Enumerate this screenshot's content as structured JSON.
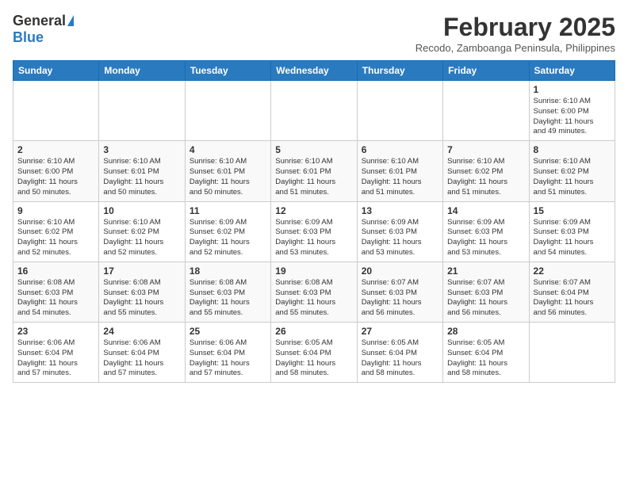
{
  "header": {
    "logo_general": "General",
    "logo_blue": "Blue",
    "month_title": "February 2025",
    "subtitle": "Recodo, Zamboanga Peninsula, Philippines"
  },
  "days_of_week": [
    "Sunday",
    "Monday",
    "Tuesday",
    "Wednesday",
    "Thursday",
    "Friday",
    "Saturday"
  ],
  "weeks": [
    [
      {
        "day": "",
        "info": ""
      },
      {
        "day": "",
        "info": ""
      },
      {
        "day": "",
        "info": ""
      },
      {
        "day": "",
        "info": ""
      },
      {
        "day": "",
        "info": ""
      },
      {
        "day": "",
        "info": ""
      },
      {
        "day": "1",
        "info": "Sunrise: 6:10 AM\nSunset: 6:00 PM\nDaylight: 11 hours\nand 49 minutes."
      }
    ],
    [
      {
        "day": "2",
        "info": "Sunrise: 6:10 AM\nSunset: 6:00 PM\nDaylight: 11 hours\nand 50 minutes."
      },
      {
        "day": "3",
        "info": "Sunrise: 6:10 AM\nSunset: 6:01 PM\nDaylight: 11 hours\nand 50 minutes."
      },
      {
        "day": "4",
        "info": "Sunrise: 6:10 AM\nSunset: 6:01 PM\nDaylight: 11 hours\nand 50 minutes."
      },
      {
        "day": "5",
        "info": "Sunrise: 6:10 AM\nSunset: 6:01 PM\nDaylight: 11 hours\nand 51 minutes."
      },
      {
        "day": "6",
        "info": "Sunrise: 6:10 AM\nSunset: 6:01 PM\nDaylight: 11 hours\nand 51 minutes."
      },
      {
        "day": "7",
        "info": "Sunrise: 6:10 AM\nSunset: 6:02 PM\nDaylight: 11 hours\nand 51 minutes."
      },
      {
        "day": "8",
        "info": "Sunrise: 6:10 AM\nSunset: 6:02 PM\nDaylight: 11 hours\nand 51 minutes."
      }
    ],
    [
      {
        "day": "9",
        "info": "Sunrise: 6:10 AM\nSunset: 6:02 PM\nDaylight: 11 hours\nand 52 minutes."
      },
      {
        "day": "10",
        "info": "Sunrise: 6:10 AM\nSunset: 6:02 PM\nDaylight: 11 hours\nand 52 minutes."
      },
      {
        "day": "11",
        "info": "Sunrise: 6:09 AM\nSunset: 6:02 PM\nDaylight: 11 hours\nand 52 minutes."
      },
      {
        "day": "12",
        "info": "Sunrise: 6:09 AM\nSunset: 6:03 PM\nDaylight: 11 hours\nand 53 minutes."
      },
      {
        "day": "13",
        "info": "Sunrise: 6:09 AM\nSunset: 6:03 PM\nDaylight: 11 hours\nand 53 minutes."
      },
      {
        "day": "14",
        "info": "Sunrise: 6:09 AM\nSunset: 6:03 PM\nDaylight: 11 hours\nand 53 minutes."
      },
      {
        "day": "15",
        "info": "Sunrise: 6:09 AM\nSunset: 6:03 PM\nDaylight: 11 hours\nand 54 minutes."
      }
    ],
    [
      {
        "day": "16",
        "info": "Sunrise: 6:08 AM\nSunset: 6:03 PM\nDaylight: 11 hours\nand 54 minutes."
      },
      {
        "day": "17",
        "info": "Sunrise: 6:08 AM\nSunset: 6:03 PM\nDaylight: 11 hours\nand 55 minutes."
      },
      {
        "day": "18",
        "info": "Sunrise: 6:08 AM\nSunset: 6:03 PM\nDaylight: 11 hours\nand 55 minutes."
      },
      {
        "day": "19",
        "info": "Sunrise: 6:08 AM\nSunset: 6:03 PM\nDaylight: 11 hours\nand 55 minutes."
      },
      {
        "day": "20",
        "info": "Sunrise: 6:07 AM\nSunset: 6:03 PM\nDaylight: 11 hours\nand 56 minutes."
      },
      {
        "day": "21",
        "info": "Sunrise: 6:07 AM\nSunset: 6:03 PM\nDaylight: 11 hours\nand 56 minutes."
      },
      {
        "day": "22",
        "info": "Sunrise: 6:07 AM\nSunset: 6:04 PM\nDaylight: 11 hours\nand 56 minutes."
      }
    ],
    [
      {
        "day": "23",
        "info": "Sunrise: 6:06 AM\nSunset: 6:04 PM\nDaylight: 11 hours\nand 57 minutes."
      },
      {
        "day": "24",
        "info": "Sunrise: 6:06 AM\nSunset: 6:04 PM\nDaylight: 11 hours\nand 57 minutes."
      },
      {
        "day": "25",
        "info": "Sunrise: 6:06 AM\nSunset: 6:04 PM\nDaylight: 11 hours\nand 57 minutes."
      },
      {
        "day": "26",
        "info": "Sunrise: 6:05 AM\nSunset: 6:04 PM\nDaylight: 11 hours\nand 58 minutes."
      },
      {
        "day": "27",
        "info": "Sunrise: 6:05 AM\nSunset: 6:04 PM\nDaylight: 11 hours\nand 58 minutes."
      },
      {
        "day": "28",
        "info": "Sunrise: 6:05 AM\nSunset: 6:04 PM\nDaylight: 11 hours\nand 58 minutes."
      },
      {
        "day": "",
        "info": ""
      }
    ]
  ]
}
